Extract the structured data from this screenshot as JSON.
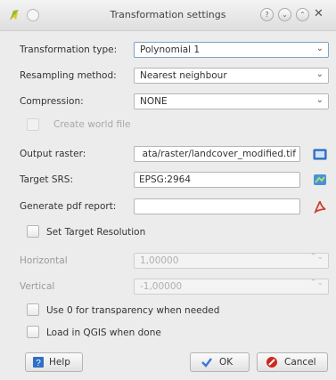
{
  "window": {
    "title": "Transformation settings",
    "help_glyph": "?",
    "min_glyph": "⌄",
    "max_glyph": "⌃",
    "close_glyph": "✕"
  },
  "form": {
    "transformation_type": {
      "label": "Transformation type:",
      "value": "Polynomial 1"
    },
    "resampling_method": {
      "label": "Resampling method:",
      "value": "Nearest neighbour"
    },
    "compression": {
      "label": "Compression:",
      "value": "NONE"
    },
    "create_world_file": {
      "label": "Create world file",
      "checked": false,
      "enabled": false
    },
    "output_raster": {
      "label": "Output raster:",
      "value": "ata/raster/landcover_modified.tif"
    },
    "target_srs": {
      "label": "Target SRS:",
      "value": "EPSG:2964"
    },
    "generate_pdf_report": {
      "label": "Generate pdf report:",
      "value": ""
    },
    "set_target_resolution": {
      "label": "Set Target Resolution",
      "checked": false
    },
    "horizontal": {
      "label": "Horizontal",
      "value": "1,00000"
    },
    "vertical": {
      "label": "Vertical",
      "value": "-1,00000"
    },
    "use_zero_transparency": {
      "label": "Use 0 for transparency when needed",
      "checked": false
    },
    "load_in_qgis": {
      "label": "Load in QGIS when done",
      "checked": false
    }
  },
  "icons": {
    "combo_arrow": "⌄",
    "spin_arrows": "⌃⌄"
  },
  "buttons": {
    "help": "Help",
    "ok": "OK",
    "cancel": "Cancel"
  },
  "colors": {
    "ok_check": "#3a7bd5",
    "cancel_red": "#d0281c",
    "help_blue": "#2f6fc7",
    "pdf_red": "#d33a2c"
  }
}
